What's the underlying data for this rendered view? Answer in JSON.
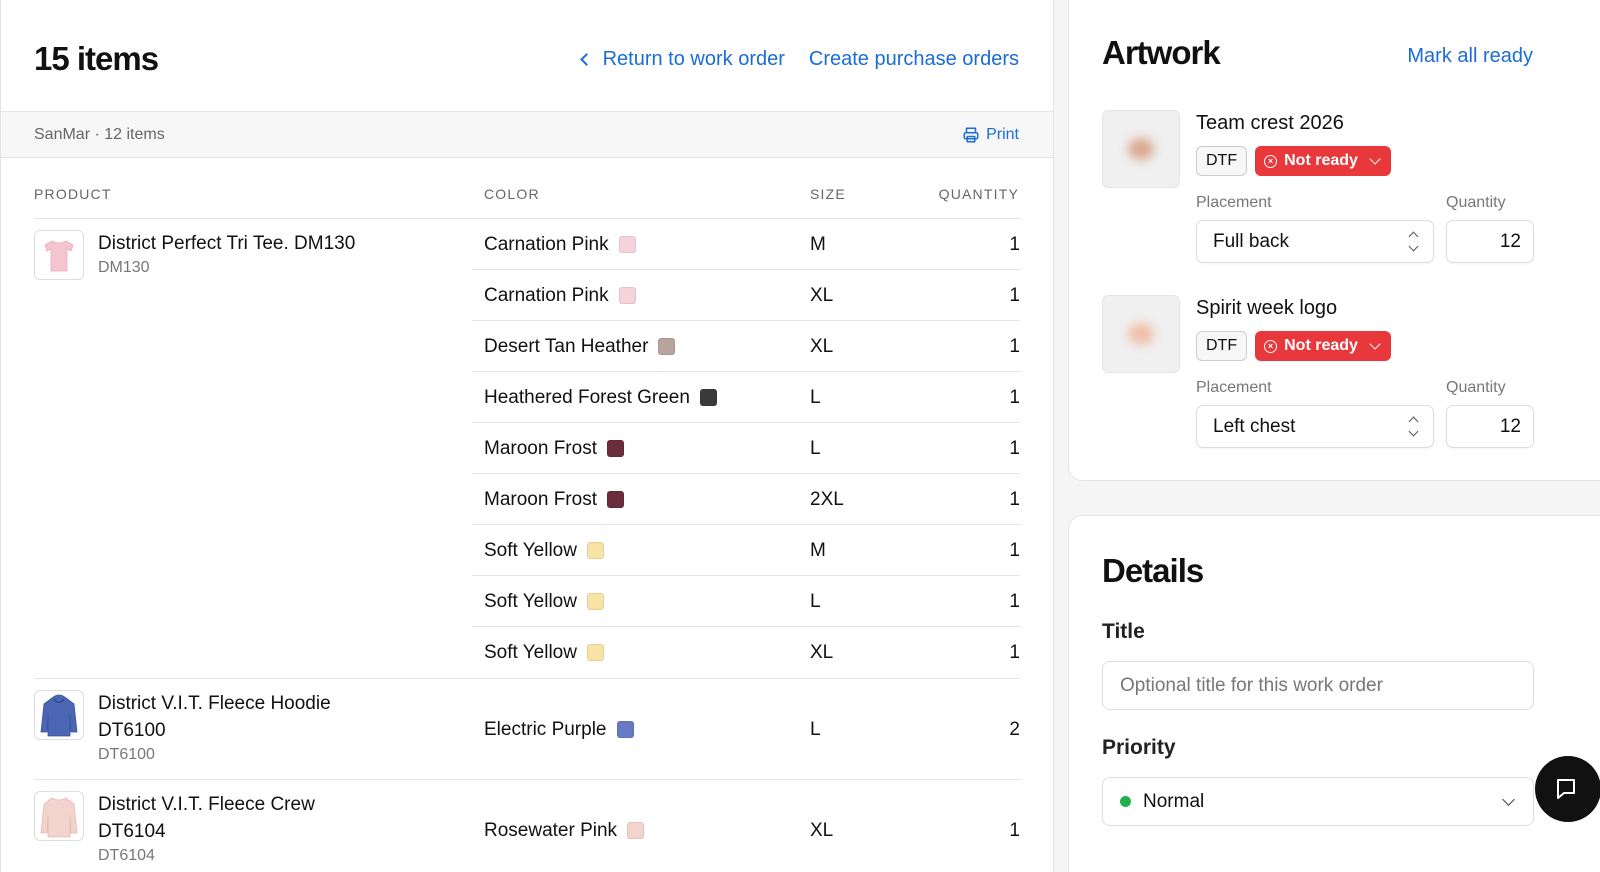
{
  "header": {
    "title": "15 items",
    "return_link": "Return to work order",
    "create_po_link": "Create purchase orders"
  },
  "vendor": {
    "label": "SanMar · 12 items",
    "print": "Print"
  },
  "table": {
    "headers": {
      "product": "PRODUCT",
      "color": "COLOR",
      "size": "SIZE",
      "quantity": "QUANTITY"
    },
    "products": [
      {
        "name": "District Perfect Tri Tee. DM130",
        "sku": "DM130"
      },
      {
        "name": "District V.I.T. Fleece Hoodie DT6100",
        "sku": "DT6100"
      },
      {
        "name": "District V.I.T. Fleece Crew DT6104",
        "sku": "DT6104"
      }
    ],
    "rows": [
      {
        "color": "Carnation Pink",
        "swatch": "#f4d4da",
        "size": "M",
        "qty": "1"
      },
      {
        "color": "Carnation Pink",
        "swatch": "#f4d4da",
        "size": "XL",
        "qty": "1"
      },
      {
        "color": "Desert Tan Heather",
        "swatch": "#b9a49d",
        "size": "XL",
        "qty": "1"
      },
      {
        "color": "Heathered Forest Green",
        "swatch": "#3a3a3a",
        "size": "L",
        "qty": "1"
      },
      {
        "color": "Maroon Frost",
        "swatch": "#6b2c3c",
        "size": "L",
        "qty": "1"
      },
      {
        "color": "Maroon Frost",
        "swatch": "#6b2c3c",
        "size": "2XL",
        "qty": "1"
      },
      {
        "color": "Soft Yellow",
        "swatch": "#f7e3a6",
        "size": "M",
        "qty": "1"
      },
      {
        "color": "Soft Yellow",
        "swatch": "#f7e3a6",
        "size": "L",
        "qty": "1"
      },
      {
        "color": "Soft Yellow",
        "swatch": "#f7e3a6",
        "size": "XL",
        "qty": "1"
      },
      {
        "color": "Electric Purple",
        "swatch": "#6679c4",
        "size": "L",
        "qty": "2"
      },
      {
        "color": "Rosewater Pink",
        "swatch": "#f2d3cd",
        "size": "XL",
        "qty": "1"
      }
    ]
  },
  "artwork": {
    "title": "Artwork",
    "mark_all_ready": "Mark all ready",
    "placement_label": "Placement",
    "quantity_label": "Quantity",
    "items": [
      {
        "name": "Team crest 2026",
        "method": "DTF",
        "status": "Not ready",
        "placement": "Full back",
        "quantity": "12"
      },
      {
        "name": "Spirit week logo",
        "method": "DTF",
        "status": "Not ready",
        "placement": "Left chest",
        "quantity": "12"
      }
    ]
  },
  "details": {
    "title": "Details",
    "title_label": "Title",
    "title_placeholder": "Optional title for this work order",
    "priority_label": "Priority",
    "priority_value": "Normal"
  },
  "colors": {
    "accent": "#1a6cd8",
    "danger": "#e8383b",
    "priority_dot": "#22b14c"
  }
}
